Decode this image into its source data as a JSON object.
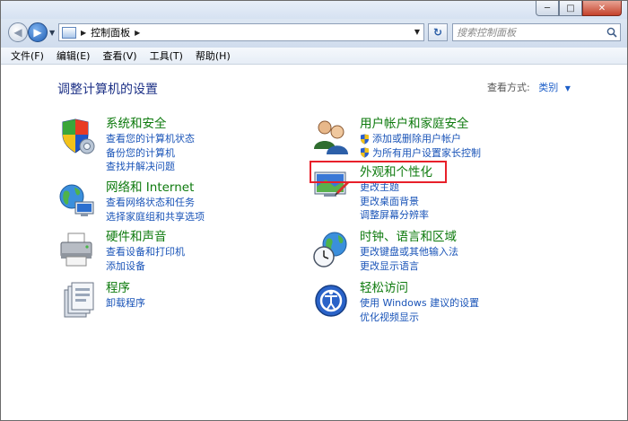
{
  "window": {
    "caption_minimize": "─",
    "caption_maximize": "□",
    "caption_close": "✕"
  },
  "navbar": {
    "breadcrumb": "控制面板",
    "search_placeholder": "搜索控制面板"
  },
  "menu": [
    "文件(F)",
    "编辑(E)",
    "查看(V)",
    "工具(T)",
    "帮助(H)"
  ],
  "main": {
    "title": "调整计算机的设置",
    "view_by_label": "查看方式:",
    "view_by_value": "类别"
  },
  "categories": [
    {
      "title": "系统和安全",
      "icon": "system-security-icon",
      "links": [
        "查看您的计算机状态",
        "备份您的计算机",
        "查找并解决问题"
      ]
    },
    {
      "title": "网络和 Internet",
      "icon": "network-icon",
      "links": [
        "查看网络状态和任务",
        "选择家庭组和共享选项"
      ]
    },
    {
      "title": "硬件和声音",
      "icon": "printer-icon",
      "links": [
        "查看设备和打印机",
        "添加设备"
      ]
    },
    {
      "title": "程序",
      "icon": "programs-icon",
      "links": [
        "卸载程序"
      ]
    },
    {
      "title": "用户帐户和家庭安全",
      "icon": "users-icon",
      "links": [
        "添加或删除用户帐户",
        "为所有用户设置家长控制"
      ]
    },
    {
      "title": "外观和个性化",
      "icon": "appearance-icon",
      "links": [
        "更改主题",
        "更改桌面背景",
        "调整屏幕分辨率"
      ]
    },
    {
      "title": "时钟、语言和区域",
      "icon": "clock-globe-icon",
      "links": [
        "更改键盘或其他输入法",
        "更改显示语言"
      ]
    },
    {
      "title": "轻松访问",
      "icon": "ease-of-access-icon",
      "links": [
        "使用 Windows 建议的设置",
        "优化视频显示"
      ]
    }
  ],
  "colors": {
    "category_title": "#0d7a0d",
    "link": "#1a54b8",
    "highlight_box": "#e8202a",
    "page_title": "#1e3287"
  }
}
